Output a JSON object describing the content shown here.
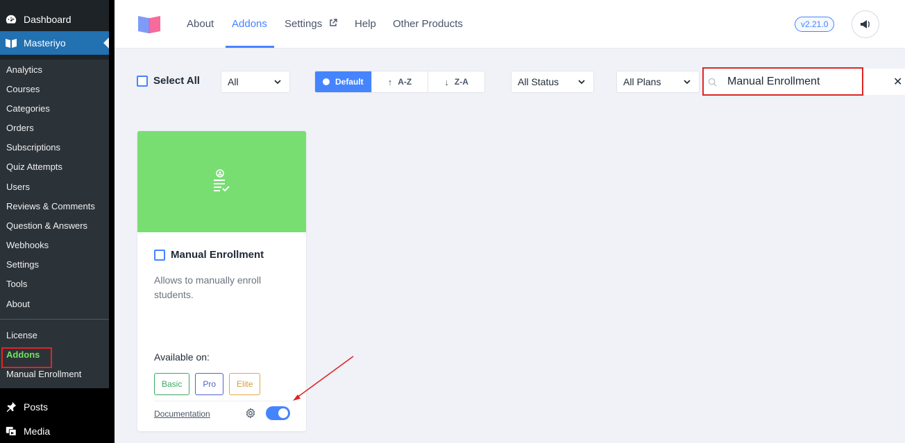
{
  "wp_menu": {
    "dashboard": "Dashboard",
    "masteriyo": "Masteriyo",
    "posts": "Posts",
    "media": "Media",
    "submenu": [
      "Analytics",
      "Courses",
      "Categories",
      "Orders",
      "Subscriptions",
      "Quiz Attempts",
      "Users",
      "Reviews & Comments",
      "Question & Answers",
      "Webhooks",
      "Settings",
      "Tools",
      "About",
      "License",
      "Addons",
      "Manual Enrollment"
    ]
  },
  "header": {
    "nav": [
      "About",
      "Addons",
      "Settings",
      "Help",
      "Other Products"
    ],
    "active_tab": "Addons",
    "version": "v2.21.0"
  },
  "toolbar": {
    "select_all": "Select All",
    "category_filter": "All",
    "sort": [
      "Default",
      "A-Z",
      "Z-A"
    ],
    "active_sort": "Default",
    "status_filter": "All Status",
    "plan_filter": "All Plans",
    "search_value": "Manual Enrollment"
  },
  "addon_card": {
    "title": "Manual Enrollment",
    "description": "Allows to manually enroll students.",
    "available_label": "Available on:",
    "plans": [
      "Basic",
      "Pro",
      "Elite"
    ],
    "documentation": "Documentation",
    "enabled": true,
    "banner_color": "#78de72"
  },
  "colors": {
    "accent": "#4584ff",
    "highlight": "#e02424",
    "wp_active": "#2271b1"
  }
}
